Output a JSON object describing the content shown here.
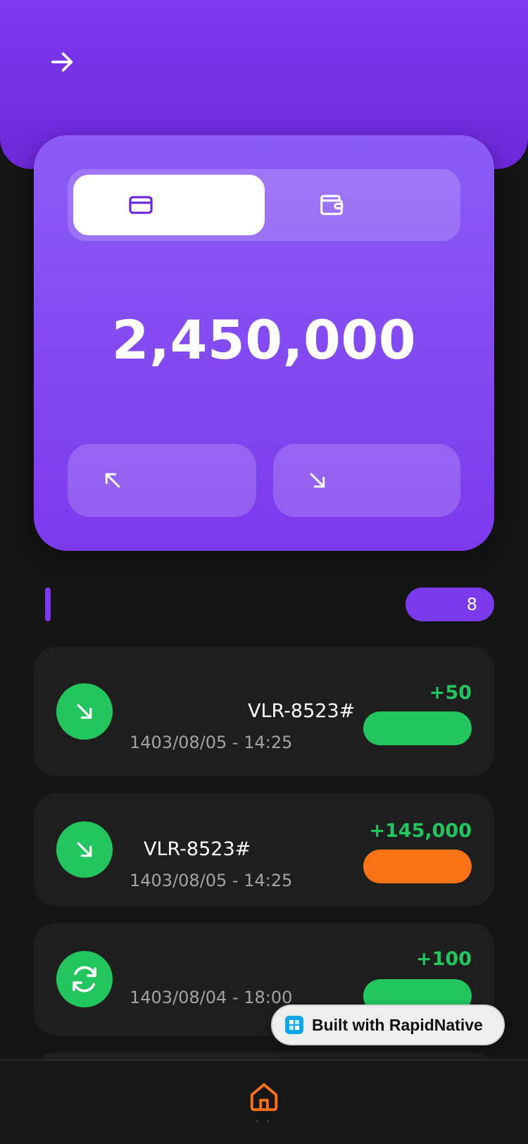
{
  "colors": {
    "accent": "#7c3aed",
    "success": "#22c55e",
    "warning": "#f97316",
    "background": "#151515",
    "card": "#1e1e1e"
  },
  "header": {
    "back_icon": "arrow-right-icon"
  },
  "balance": {
    "amount": "2,450,000",
    "tabs": [
      {
        "icon": "credit-card-icon",
        "active": true
      },
      {
        "icon": "wallet-icon",
        "active": false
      }
    ],
    "actions": [
      {
        "icon": "arrow-up-left-icon"
      },
      {
        "icon": "arrow-down-right-icon"
      }
    ]
  },
  "transactions_section": {
    "count": "8"
  },
  "transactions": [
    {
      "icon": "arrow-down-right-icon",
      "ref": "VLR-8523#",
      "date": "1403/08/05 - 14:25",
      "amount": "+50",
      "status_color": "#22c55e"
    },
    {
      "icon": "arrow-down-right-icon",
      "ref": "VLR-8523#",
      "date": "1403/08/05 - 14:25",
      "amount": "+145,000",
      "status_color": "#f97316"
    },
    {
      "icon": "refresh-icon",
      "ref": "",
      "date": "1403/08/04 - 18:00",
      "amount": "+100",
      "status_color": "#22c55e"
    }
  ],
  "badge": {
    "text": "Built with RapidNative"
  },
  "tabbar": {
    "home_icon": "home-icon",
    "home_dots": "· ·"
  }
}
